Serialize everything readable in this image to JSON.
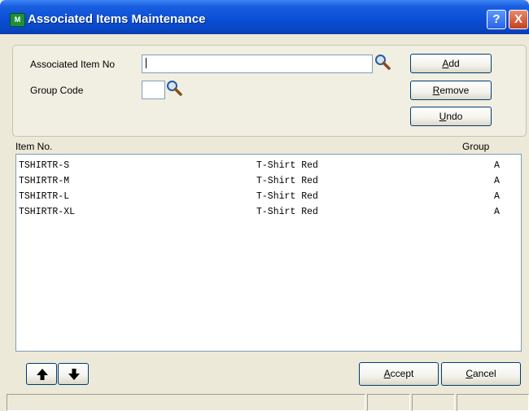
{
  "window": {
    "title": "Associated Items Maintenance",
    "help_label": "?",
    "close_label": "X",
    "app_icon_label": "M"
  },
  "form": {
    "associated_item_label": "Associated Item No",
    "associated_item_value": "",
    "group_code_label": "Group Code",
    "group_code_value": ""
  },
  "buttons": {
    "add": {
      "accel": "A",
      "rest": "dd"
    },
    "remove": {
      "accel": "R",
      "rest": "emove"
    },
    "undo": {
      "accel": "U",
      "rest": "ndo"
    },
    "accept": {
      "accel": "A",
      "rest": "ccept"
    },
    "cancel": {
      "accel": "C",
      "rest": "ancel"
    }
  },
  "list": {
    "columns": [
      "Item No.",
      "Group"
    ],
    "rows": [
      {
        "item_no": "TSHIRTR-S",
        "description": "T-Shirt Red",
        "group": "A"
      },
      {
        "item_no": "TSHIRTR-M",
        "description": "T-Shirt Red",
        "group": "A"
      },
      {
        "item_no": "TSHIRTR-L",
        "description": "T-Shirt Red",
        "group": "A"
      },
      {
        "item_no": "TSHIRTR-XL",
        "description": "T-Shirt Red",
        "group": "A"
      }
    ]
  },
  "icons": {
    "lookup": "magnifier-icon",
    "move_up": "arrow-up-icon",
    "move_down": "arrow-down-icon"
  },
  "colors": {
    "titlebar": "#0A4FD6",
    "window_bg": "#ECE9D8",
    "button_border": "#003C74",
    "input_border": "#7F9DB9"
  }
}
